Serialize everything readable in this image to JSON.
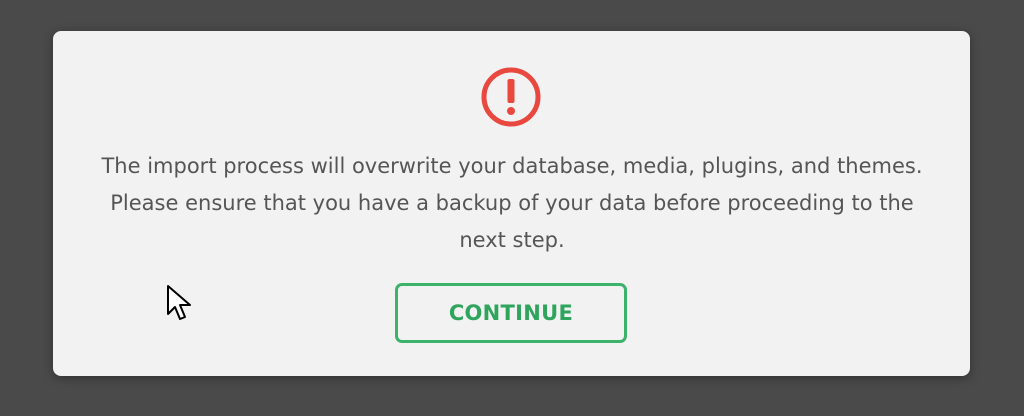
{
  "dialog": {
    "message": "The import process will overwrite your database, media, plugins, and themes. Please ensure that you have a backup of your data before proceeding to the next step.",
    "continue_label": "CONTINUE",
    "icon": "exclamation-circle-icon"
  },
  "colors": {
    "backdrop": "#4a4a4a",
    "dialog_bg": "#f2f2f2",
    "warning": "#e8483e",
    "button_accent": "#3cb26a",
    "text": "#555555"
  }
}
